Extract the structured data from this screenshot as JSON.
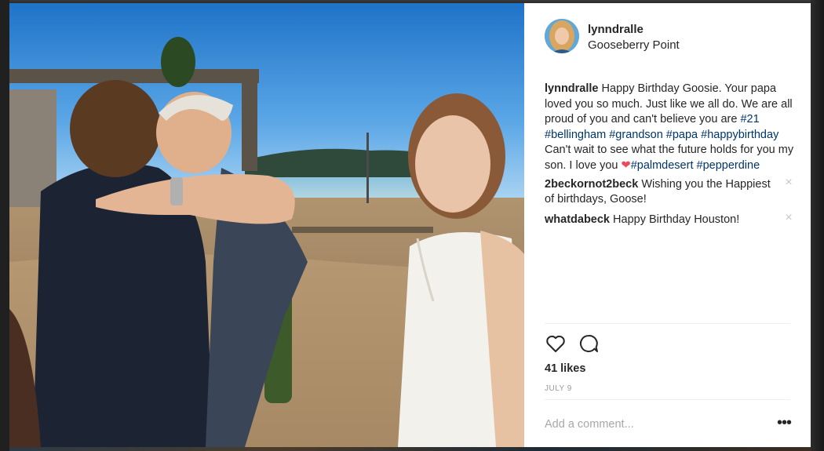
{
  "post": {
    "username": "lynndralle",
    "location": "Gooseberry Point",
    "caption": {
      "username": "lynndralle",
      "text_1": "Happy Birthday Goosie. Your papa loved you so much. Just like we all do. We are all proud of you and can't believe you are",
      "tag_21": "#21",
      "tag_bellingham": "#bellingham",
      "tag_grandson": "#grandson",
      "tag_papa": "#papa",
      "tag_happybirthday": "#happybirthday",
      "text_2": "Can't wait to see what the future holds for you my son. I love you",
      "heart": "❤",
      "tag_palmdesert": "#palmdesert",
      "tag_pepperdine": "#pepperdine"
    },
    "comments": [
      {
        "username": "2beckornot2beck",
        "text": "Wishing you the Happiest of birthdays, Goose!",
        "remove_icon": "close-icon"
      },
      {
        "username": "whatdabeck",
        "text": "Happy Birthday Houston!",
        "remove_icon": "close-icon"
      }
    ],
    "likes": "41 likes",
    "date": "JULY 9",
    "add_comment_placeholder": "Add a comment...",
    "more_label": "•••",
    "icons": {
      "like": "heart-outline-icon",
      "comment": "speech-bubble-icon",
      "more": "ellipsis-icon"
    }
  },
  "colors": {
    "text": "#262626",
    "hashtag": "#003569",
    "muted": "#999999",
    "divider": "#efefef",
    "heart": "#ed4956"
  }
}
